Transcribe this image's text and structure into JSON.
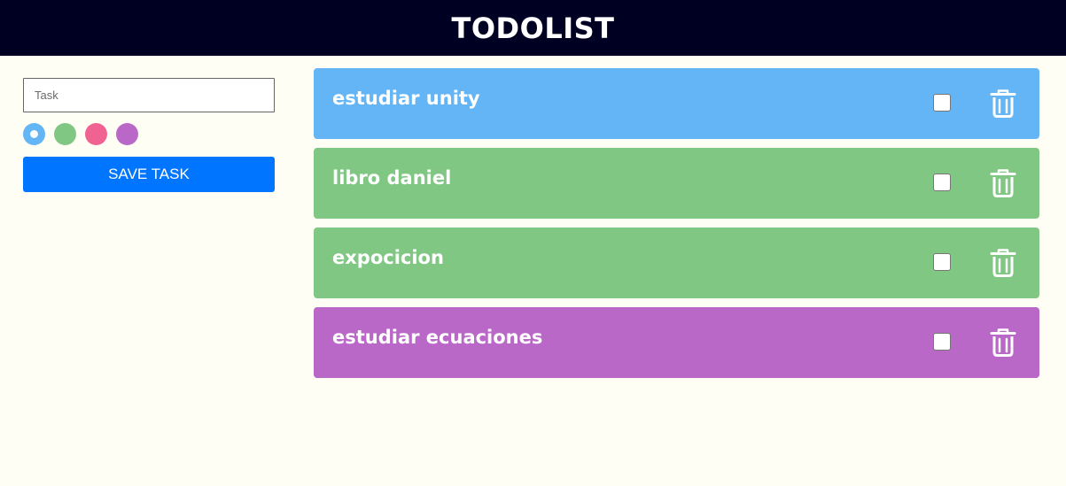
{
  "header": {
    "title": "TODOLIST"
  },
  "form": {
    "task_placeholder": "Task",
    "task_value": "",
    "colors": [
      {
        "name": "blue",
        "hex": "#64b5f6",
        "selected": true
      },
      {
        "name": "green",
        "hex": "#81c784",
        "selected": false
      },
      {
        "name": "pink",
        "hex": "#f06292",
        "selected": false
      },
      {
        "name": "purple",
        "hex": "#ba68c8",
        "selected": false
      }
    ],
    "save_label": "SAVE TASK"
  },
  "tasks": [
    {
      "title": "estudiar unity",
      "color": "#64b5f6",
      "done": false,
      "delete_icon": "trash-icon"
    },
    {
      "title": "libro daniel",
      "color": "#81c784",
      "done": false,
      "delete_icon": "trash-icon"
    },
    {
      "title": "expocicion",
      "color": "#81c784",
      "done": false,
      "delete_icon": "trash-icon"
    },
    {
      "title": "estudiar ecuaciones",
      "color": "#ba68c8",
      "done": false,
      "delete_icon": "trash-icon"
    }
  ]
}
